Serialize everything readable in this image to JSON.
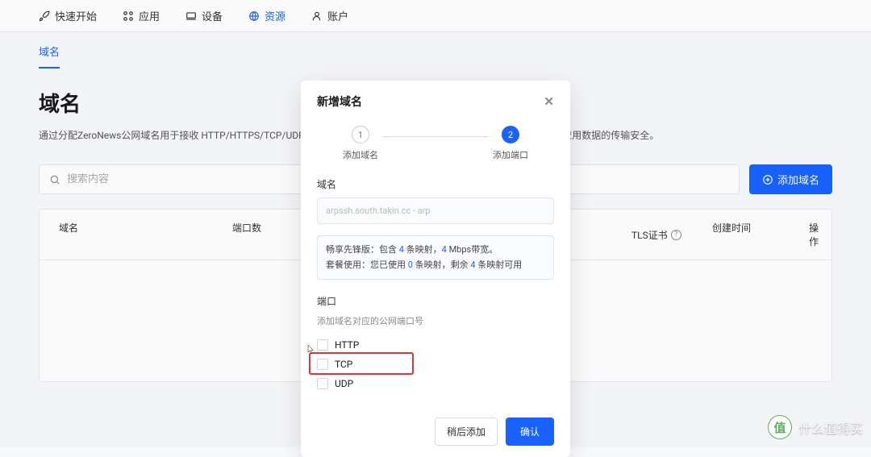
{
  "topnav": {
    "items": [
      {
        "label": "快速开始",
        "name": "quickstart"
      },
      {
        "label": "应用",
        "name": "apps"
      },
      {
        "label": "设备",
        "name": "devices"
      },
      {
        "label": "资源",
        "name": "resources",
        "active": true
      },
      {
        "label": "账户",
        "name": "account"
      }
    ]
  },
  "subnav": {
    "active_label": "域名"
  },
  "page": {
    "title": "域名",
    "description": "通过分配ZeroNews公网域名用于接收 HTTP/HTTPS/TCP/UDP的                                                                                                                HTTPS访问请求，由ZeroNews统一分配TLS证书，以满足应用数据的传输安全。"
  },
  "toolbar": {
    "search_placeholder": "搜索内容",
    "add_button_label": "添加域名"
  },
  "table": {
    "headers": {
      "domain": "域名",
      "port_count": "端口数",
      "tls": "TLS证书",
      "created": "创建时间",
      "action": "操作"
    }
  },
  "modal": {
    "title": "新增域名",
    "steps": {
      "step1": {
        "num": "1",
        "label": "添加域名"
      },
      "step2": {
        "num": "2",
        "label": "添加端口"
      }
    },
    "domain_section": {
      "label": "域名",
      "value": "arpssh.south.takin.cc - arp"
    },
    "info": {
      "line1_a": "畅享先锋版：包含 ",
      "line1_num1": "4",
      "line1_b": " 条映射，",
      "line1_num2": "4",
      "line1_c": " Mbps带宽。",
      "line2_a": "套餐使用：您已使用 ",
      "line2_num1": "0",
      "line2_b": " 条映射，剩余 ",
      "line2_num2": "4",
      "line2_c": " 条映射可用"
    },
    "port_section": {
      "label": "端口",
      "sublabel": "添加域名对应的公网端口号",
      "options": [
        {
          "label": "HTTP"
        },
        {
          "label": "TCP"
        },
        {
          "label": "UDP"
        }
      ]
    },
    "footer": {
      "later_label": "稍后添加",
      "confirm_label": "确认"
    }
  },
  "watermark": {
    "char": "值",
    "text": "什么值得买"
  }
}
